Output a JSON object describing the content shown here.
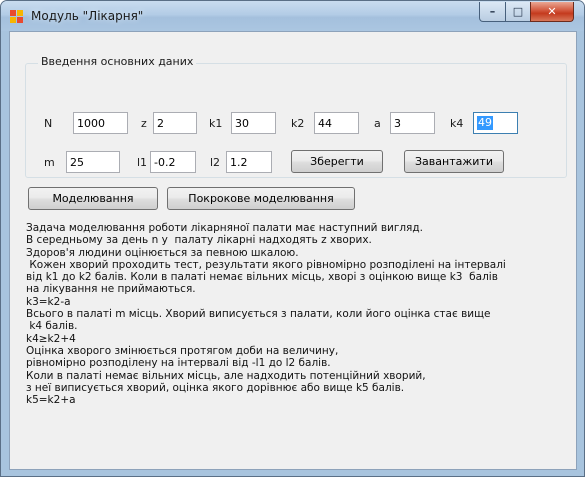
{
  "window": {
    "title": "Модуль \"Лікарня\"",
    "controls": {
      "minimize": "–",
      "maximize": "□",
      "close": "✕"
    }
  },
  "group": {
    "title": "Введення основних даних",
    "fields": {
      "N": {
        "label": "N",
        "value": "1000"
      },
      "z": {
        "label": "z",
        "value": "2"
      },
      "k1": {
        "label": "k1",
        "value": "30"
      },
      "k2": {
        "label": "k2",
        "value": "44"
      },
      "a": {
        "label": "a",
        "value": "3"
      },
      "k4": {
        "label": "k4",
        "value": "49"
      },
      "m": {
        "label": "m",
        "value": "25"
      },
      "l1": {
        "label": "l1",
        "value": "-0.2"
      },
      "l2": {
        "label": "l2",
        "value": "1.2"
      }
    },
    "save_label": "Зберегти",
    "load_label": "Завантажити"
  },
  "actions": {
    "simulate_label": "Моделювання",
    "step_simulate_label": "Покрокове моделювання"
  },
  "description": [
    "Задача моделювання роботи лікарняної палати має наступний вигляд.",
    "В середньому за день n у  палату лікарні надходять z хворих.",
    "Здоров'я людини оцінюється за певною шкалою.",
    " Кожен хворий проходить тест, результати якого рівномірно розподілені на інтервалі",
    "від k1 до k2 балів. Коли в палаті немає вільних місць, хворі з оцінкою вище k3  балів",
    "на лікування не приймаються.",
    "k3=k2-a",
    "Всього в палаті m місць. Хворий виписується з палати, коли його оцінка стає вище",
    " k4 балів.",
    "k4≥k2+4",
    "Оцінка хворого змінюється протягом доби на величину,",
    "рівномірно розподілену на інтервалі від -l1 до l2 балів.",
    "Коли в палаті немає вільних місць, але надходить потенційний хворий,",
    "з неї виписується хворий, оцінка якого дорівнює або вище k5 балів.",
    "k5=k2+a"
  ]
}
